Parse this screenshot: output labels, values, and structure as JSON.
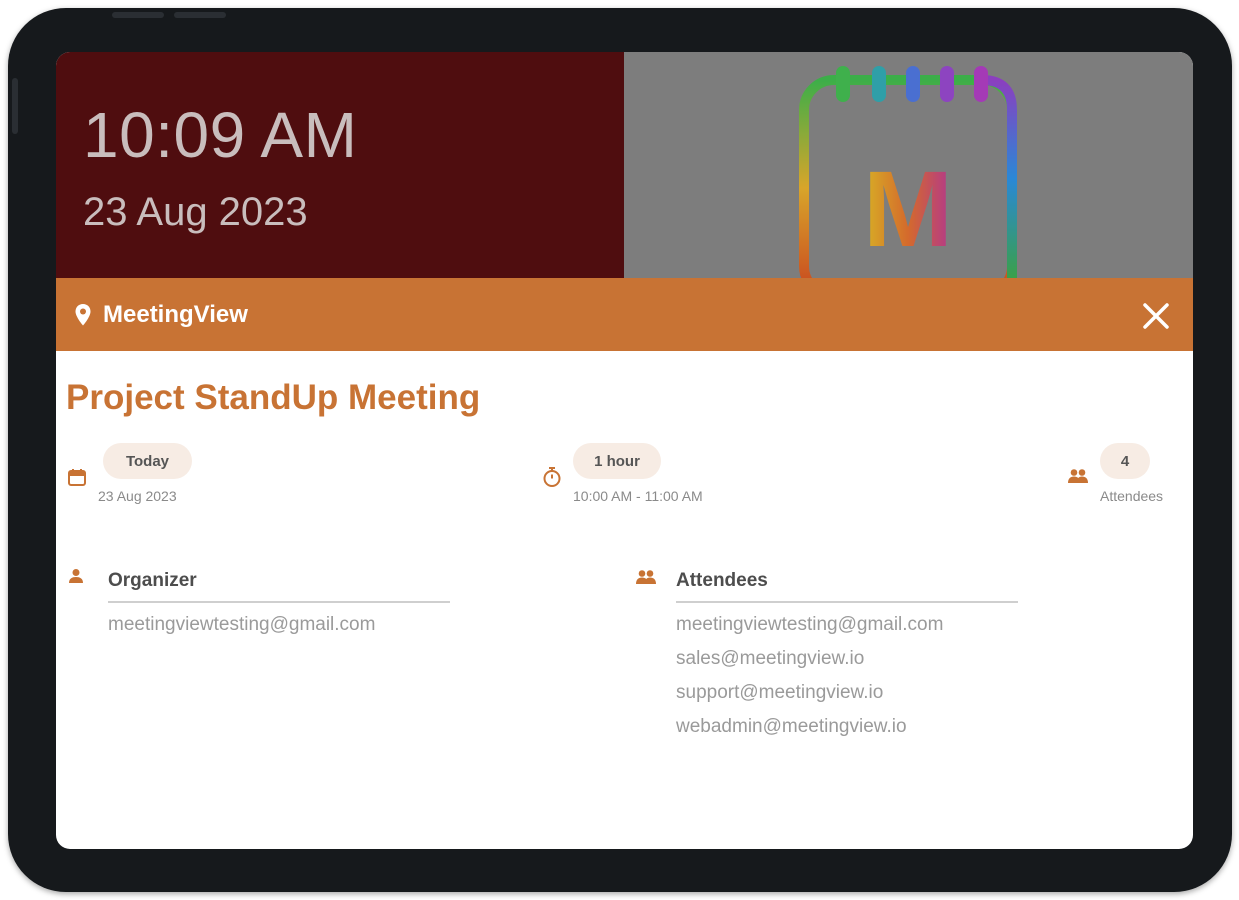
{
  "clock": {
    "time": "10:09 AM",
    "date": "23 Aug 2023"
  },
  "logo": {
    "letter": "M",
    "icon": "calendar-logo-icon"
  },
  "header": {
    "app_name": "MeetingView",
    "location_icon": "map-pin-icon",
    "close_icon": "close-icon"
  },
  "meeting": {
    "title": "Project StandUp Meeting",
    "day_badge": "Today",
    "date": "23 Aug 2023",
    "duration_badge": "1 hour",
    "time_range": "10:00 AM - 11:00 AM",
    "attendee_count": "4",
    "attendee_count_label": "Attendees"
  },
  "organizer": {
    "heading": "Organizer",
    "email": "meetingviewtesting@gmail.com"
  },
  "attendees": {
    "heading": "Attendees",
    "emails": [
      "meetingviewtesting@gmail.com",
      "sales@meetingview.io",
      "support@meetingview.io",
      "webadmin@meetingview.io"
    ]
  },
  "colors": {
    "accent": "#c87334",
    "hero_left": "#4f0d0f",
    "hero_right": "#7d7d7d",
    "bezel": "#16191c"
  }
}
